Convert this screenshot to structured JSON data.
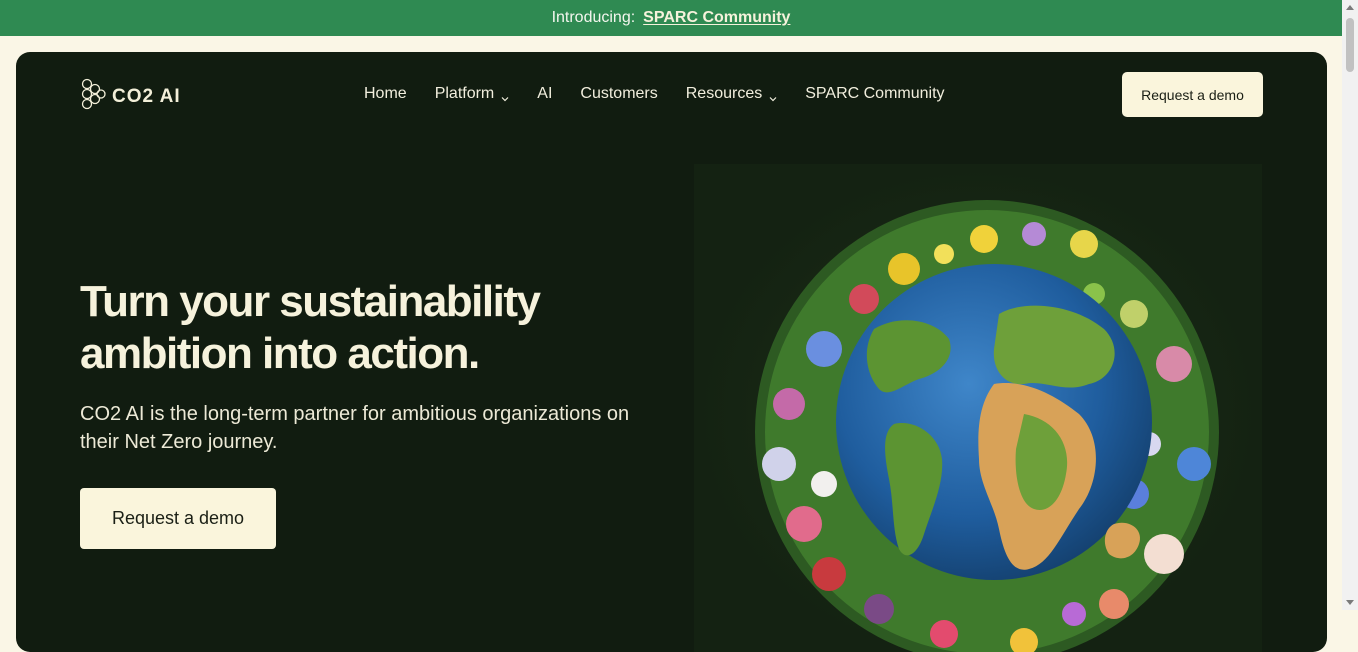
{
  "banner": {
    "intro": "Introducing:",
    "link": "SPARC Community"
  },
  "logo": {
    "text": "CO2 AI",
    "icon": "co2ai-logo-icon"
  },
  "nav": {
    "items": [
      {
        "label": "Home",
        "dropdown": false
      },
      {
        "label": "Platform",
        "dropdown": true
      },
      {
        "label": "AI",
        "dropdown": false
      },
      {
        "label": "Customers",
        "dropdown": false
      },
      {
        "label": "Resources",
        "dropdown": true
      },
      {
        "label": "SPARC Community",
        "dropdown": false
      }
    ],
    "cta": "Request a demo"
  },
  "hero": {
    "headline_line1": "Turn your sustainability",
    "headline_line2": "ambition into action.",
    "subhead": "CO2 AI is the long-term partner for ambitious organizations on their Net Zero journey.",
    "cta": "Request a demo",
    "image": "earth-globe-with-flowers-image"
  },
  "colors": {
    "banner_bg": "#2f8a52",
    "hero_bg": "#111c10",
    "page_bg": "#faf6e6",
    "button_bg": "#faf5dc"
  }
}
